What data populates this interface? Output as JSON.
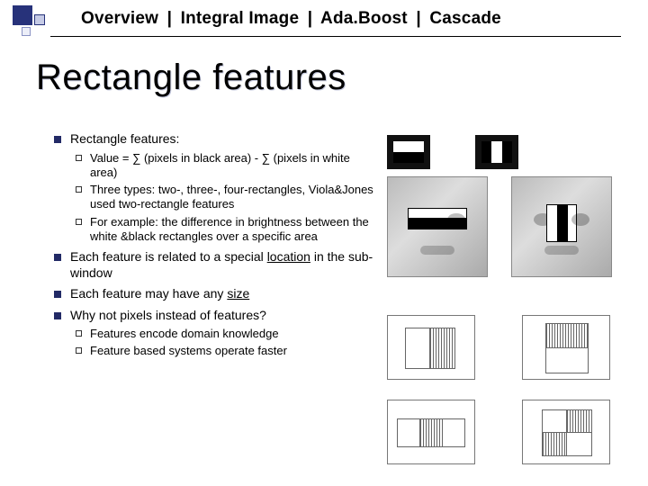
{
  "breadcrumb": {
    "items": [
      "Overview",
      "Integral Image",
      "Ada.Boost",
      "Cascade"
    ],
    "sep": "|"
  },
  "title": "Rectangle features",
  "bullets": {
    "b1": {
      "head": "Rectangle features:",
      "sub": [
        "Value =  ∑ (pixels in black area) - ∑ (pixels in white area)",
        "Three types: two-, three-, four-rectangles, Viola&Jones used two-rectangle features",
        "For example: the difference in brightness between the white &black rectangles over a specific area"
      ]
    },
    "b2_pre": "Each feature is related to a special ",
    "b2_under": "location",
    "b2_post": " in the sub-window",
    "b3_pre": "Each feature may have any ",
    "b3_under": "size",
    "b4": "Why not pixels instead of features?",
    "b4sub": [
      "Features encode domain knowledge",
      "Feature based systems operate faster"
    ]
  }
}
